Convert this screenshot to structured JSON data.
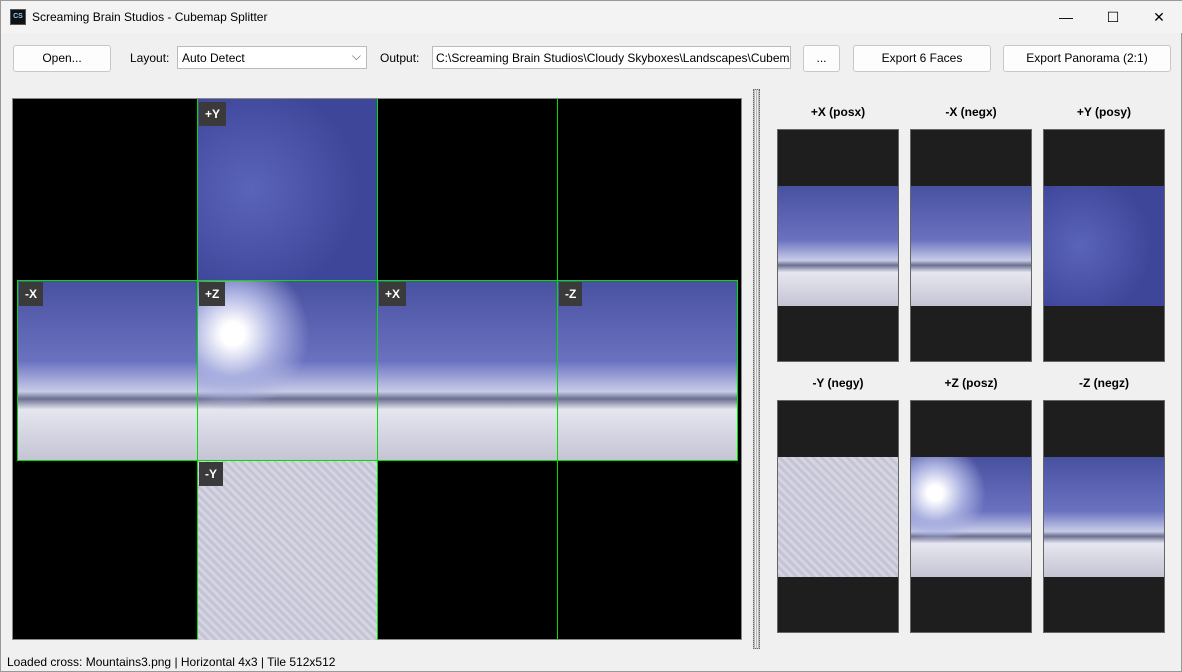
{
  "window": {
    "title": "Screaming Brain Studios - Cubemap Splitter",
    "icon_text": "CS",
    "minimize": "—",
    "maximize": "☐",
    "close": "✕"
  },
  "toolbar": {
    "open_label": "Open...",
    "layout_label": "Layout:",
    "layout_value": "Auto Detect",
    "output_label": "Output:",
    "output_value": "C:\\Screaming Brain Studios\\Cloudy Skyboxes\\Landscapes\\Cubema",
    "browse_label": "...",
    "export_faces_label": "Export 6 Faces",
    "export_panorama_label": "Export Panorama (2:1)"
  },
  "preview": {
    "grid_color": "#00e000",
    "tiles": [
      "+Y",
      "-X",
      "+Z",
      "+X",
      "-Z",
      "-Y"
    ]
  },
  "faces": [
    {
      "label": "+X (posx)"
    },
    {
      "label": "-X (negx)"
    },
    {
      "label": "+Y (posy)"
    },
    {
      "label": "-Y (negy)"
    },
    {
      "label": "+Z (posz)"
    },
    {
      "label": "-Z (negz)"
    }
  ],
  "status": "Loaded cross: Mountains3.png | Horizontal 4x3 | Tile 512x512"
}
